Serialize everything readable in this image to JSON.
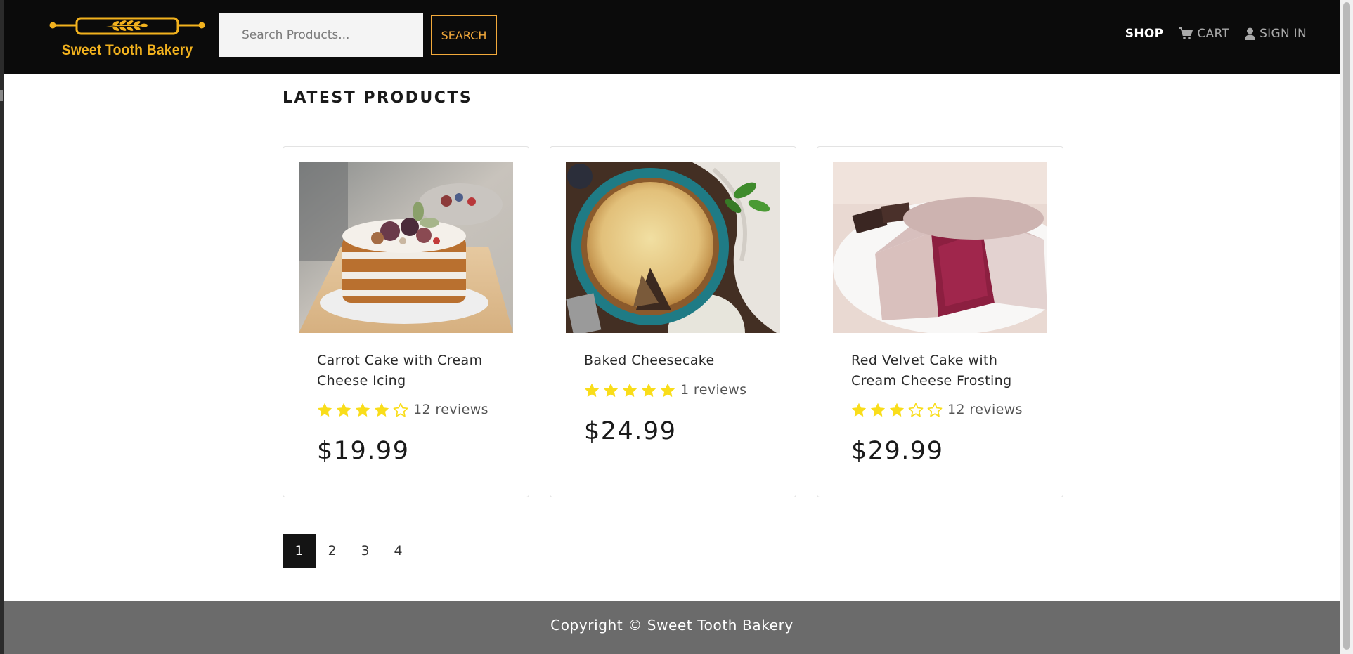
{
  "brand": {
    "name": "Sweet Tooth Bakery",
    "accent_color": "#f2b21e"
  },
  "search": {
    "placeholder": "Search Products...",
    "value": "",
    "button_label": "SEARCH"
  },
  "nav": {
    "shop": "SHOP",
    "cart": {
      "label": "CART",
      "icon": "cart-icon"
    },
    "sign_in": {
      "label": "SIGN IN",
      "icon": "user-icon"
    }
  },
  "main": {
    "title": "LATEST PRODUCTS",
    "products": [
      {
        "name": "Carrot Cake with Cream Cheese Icing",
        "rating": 4,
        "max_rating": 5,
        "reviews": "12 reviews",
        "price": "$19.99",
        "image": "carrot-cake-photo"
      },
      {
        "name": "Baked Cheesecake",
        "rating": 5,
        "max_rating": 5,
        "reviews": "1 reviews",
        "price": "$24.99",
        "image": "cheesecake-photo"
      },
      {
        "name": "Red Velvet Cake with Cream Cheese Frosting",
        "rating": 3,
        "max_rating": 5,
        "reviews": "12 reviews",
        "price": "$29.99",
        "image": "red-velvet-cake-photo"
      }
    ],
    "star_color": "#f9dd1a"
  },
  "pagination": {
    "pages": [
      "1",
      "2",
      "3",
      "4"
    ],
    "current": "1"
  },
  "footer": {
    "copyright": "Copyright © Sweet Tooth Bakery"
  }
}
